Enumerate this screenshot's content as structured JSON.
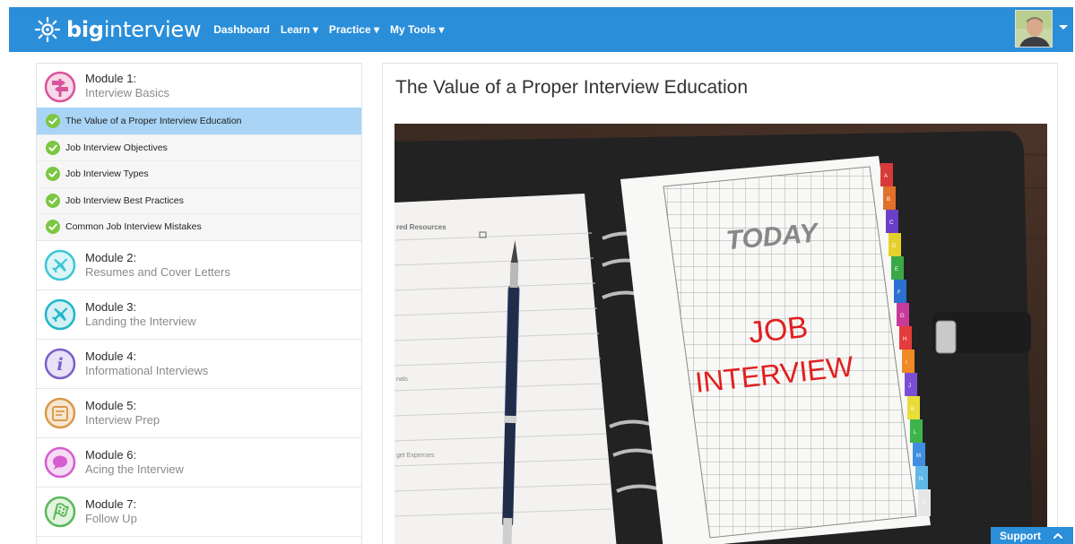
{
  "header": {
    "logo_bold": "big",
    "logo_light": "interview",
    "nav": [
      {
        "label": "Dashboard"
      },
      {
        "label": "Learn ▾"
      },
      {
        "label": "Practice ▾"
      },
      {
        "label": "My Tools ▾"
      }
    ],
    "avatar_icon": "user-avatar"
  },
  "sidebar": {
    "modules": [
      {
        "number": "Module 1:",
        "title": "Interview Basics",
        "icon": "signpost-icon",
        "color": "#d9539b"
      },
      {
        "number": "Module 2:",
        "title": "Resumes and Cover Letters",
        "icon": "airplane-icon",
        "color": "#3cc7d6"
      },
      {
        "number": "Module 3:",
        "title": "Landing the Interview",
        "icon": "airplane-icon",
        "color": "#22b5c9"
      },
      {
        "number": "Module 4:",
        "title": "Informational Interviews",
        "icon": "info-icon",
        "color": "#7a5fc9"
      },
      {
        "number": "Module 5:",
        "title": "Interview Prep",
        "icon": "notepad-icon",
        "color": "#d99a4a"
      },
      {
        "number": "Module 6:",
        "title": "Acing the Interview",
        "icon": "speech-bubble-icon",
        "color": "#d65cd0"
      },
      {
        "number": "Module 7:",
        "title": "Follow Up",
        "icon": "checkered-flag-icon",
        "color": "#5ab85a"
      }
    ],
    "lessons": [
      {
        "label": "The Value of a Proper Interview Education"
      },
      {
        "label": "Job Interview Objectives"
      },
      {
        "label": "Job Interview Types"
      },
      {
        "label": "Job Interview Best Practices"
      },
      {
        "label": "Common Job Interview Mistakes"
      }
    ],
    "check_color": "#7cc642",
    "active_color": "#a9d4f5"
  },
  "main": {
    "title": "The Value of a Proper Interview Education",
    "image": {
      "left_page_heading": "red Resources",
      "left_page_label_1": "nals",
      "left_page_label_2": "get Expenses",
      "today_text": "TODAY",
      "job_text": "JOB",
      "interview_text": "INTERVIEW",
      "tab_letters": [
        "A",
        "B",
        "C",
        "D",
        "E",
        "F",
        "G",
        "H",
        "I",
        "J",
        "K",
        "L",
        "M",
        "N",
        "O"
      ]
    }
  },
  "support": {
    "label": "Support"
  },
  "colors": {
    "brand": "#2a8ed9"
  }
}
